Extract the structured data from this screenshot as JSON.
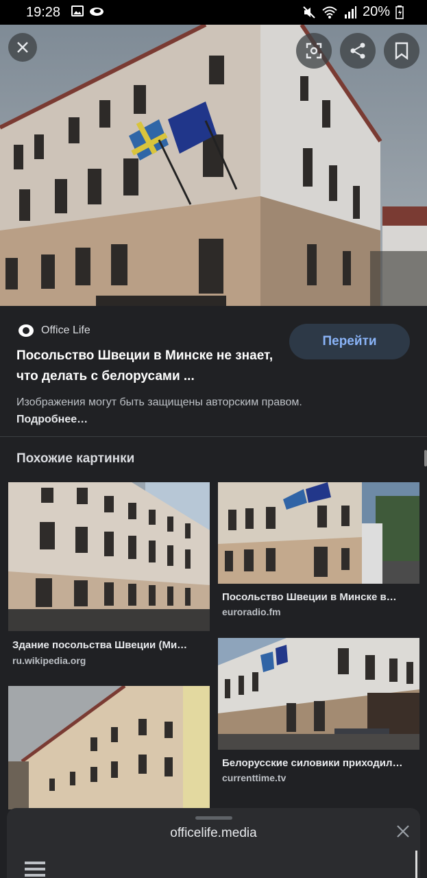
{
  "status_bar": {
    "time": "19:28",
    "battery": "20%"
  },
  "hero": {
    "close_icon": "close-icon",
    "lens_icon": "lens-icon",
    "share_icon": "share-icon",
    "save_icon": "bookmark-icon"
  },
  "source": {
    "name": "Office Life",
    "visit_label": "Перейти",
    "title": "Посольство Швеции в Минске не знает, что делать с белорусами ...",
    "copyright_text": "Изображения могут быть защищены авторским правом.",
    "more_link": "Подробнее…"
  },
  "related": {
    "heading": "Похожие картинки",
    "items": [
      {
        "caption": "Здание посольства Швеции (Ми…",
        "domain": "ru.wikipedia.org"
      },
      {
        "caption": "Посольство Швеции в Минске в…",
        "domain": "euroradio.fm"
      },
      {
        "caption": "Белорусские силовики приходил…",
        "domain": "currenttime.tv"
      }
    ]
  },
  "sheet": {
    "url": "officelife.media"
  },
  "colors": {
    "background": "#202124",
    "accent": "#8ab4f8",
    "button_bg": "#2d3947"
  }
}
